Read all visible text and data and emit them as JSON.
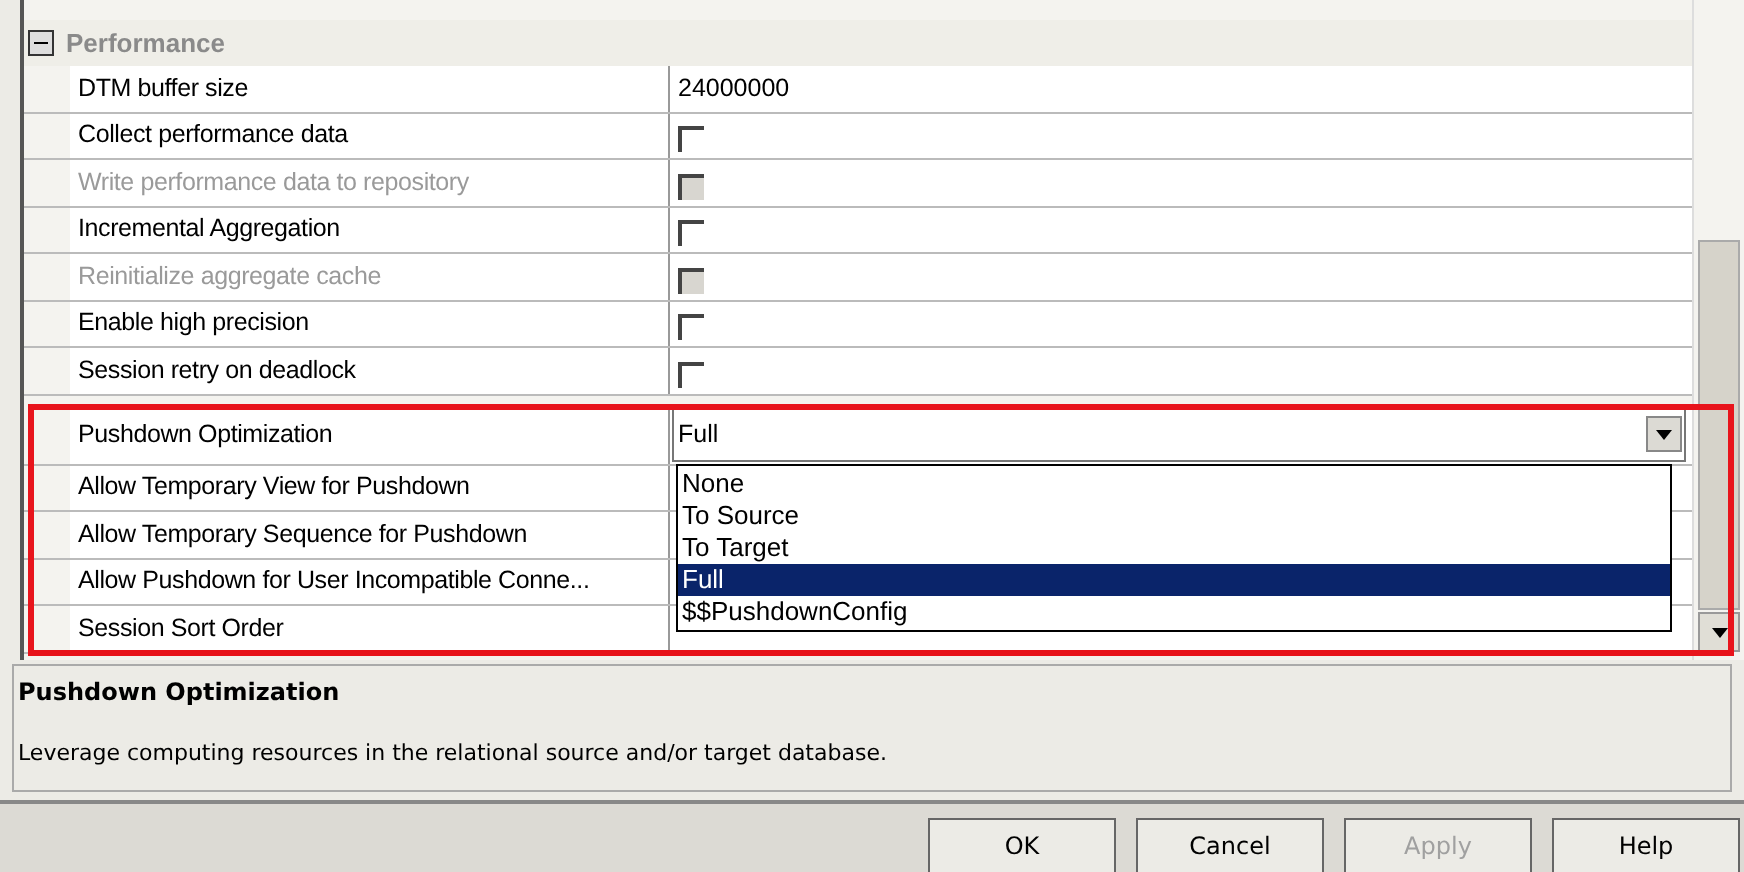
{
  "section": {
    "title": "Performance",
    "expanded": true
  },
  "properties": [
    {
      "name": "DTM buffer size",
      "kind": "text",
      "value": "24000000",
      "disabled": false
    },
    {
      "name": "Collect performance data",
      "kind": "checkbox",
      "checked": false,
      "disabled": false
    },
    {
      "name": "Write performance data to repository",
      "kind": "checkbox",
      "checked": false,
      "disabled": true
    },
    {
      "name": "Incremental Aggregation",
      "kind": "checkbox",
      "checked": false,
      "disabled": false
    },
    {
      "name": "Reinitialize aggregate cache",
      "kind": "checkbox",
      "checked": false,
      "disabled": true
    },
    {
      "name": "Enable high precision",
      "kind": "checkbox",
      "checked": false,
      "disabled": false
    },
    {
      "name": "Session retry on deadlock",
      "kind": "checkbox",
      "checked": false,
      "disabled": false
    },
    {
      "name": "Pushdown Optimization",
      "kind": "dropdown",
      "value": "Full",
      "disabled": false
    },
    {
      "name": "Allow Temporary View for Pushdown",
      "kind": "hidden",
      "disabled": false
    },
    {
      "name": "Allow Temporary Sequence for Pushdown",
      "kind": "hidden",
      "disabled": false
    },
    {
      "name": "Allow Pushdown for User Incompatible Conne...",
      "kind": "hidden",
      "disabled": false
    },
    {
      "name": "Session Sort Order",
      "kind": "hidden",
      "disabled": false
    }
  ],
  "dropdown_options": [
    {
      "label": "None",
      "selected": false
    },
    {
      "label": "To Source",
      "selected": false
    },
    {
      "label": "To Target",
      "selected": false
    },
    {
      "label": "Full",
      "selected": true
    },
    {
      "label": "$$PushdownConfig",
      "selected": false
    }
  ],
  "description": {
    "title": "Pushdown Optimization",
    "text": "Leverage computing resources in the relational source and/or target database."
  },
  "buttons": [
    {
      "label": "OK",
      "disabled": false
    },
    {
      "label": "Cancel",
      "disabled": false
    },
    {
      "label": "Apply",
      "disabled": true
    },
    {
      "label": "Help",
      "disabled": false
    }
  ]
}
